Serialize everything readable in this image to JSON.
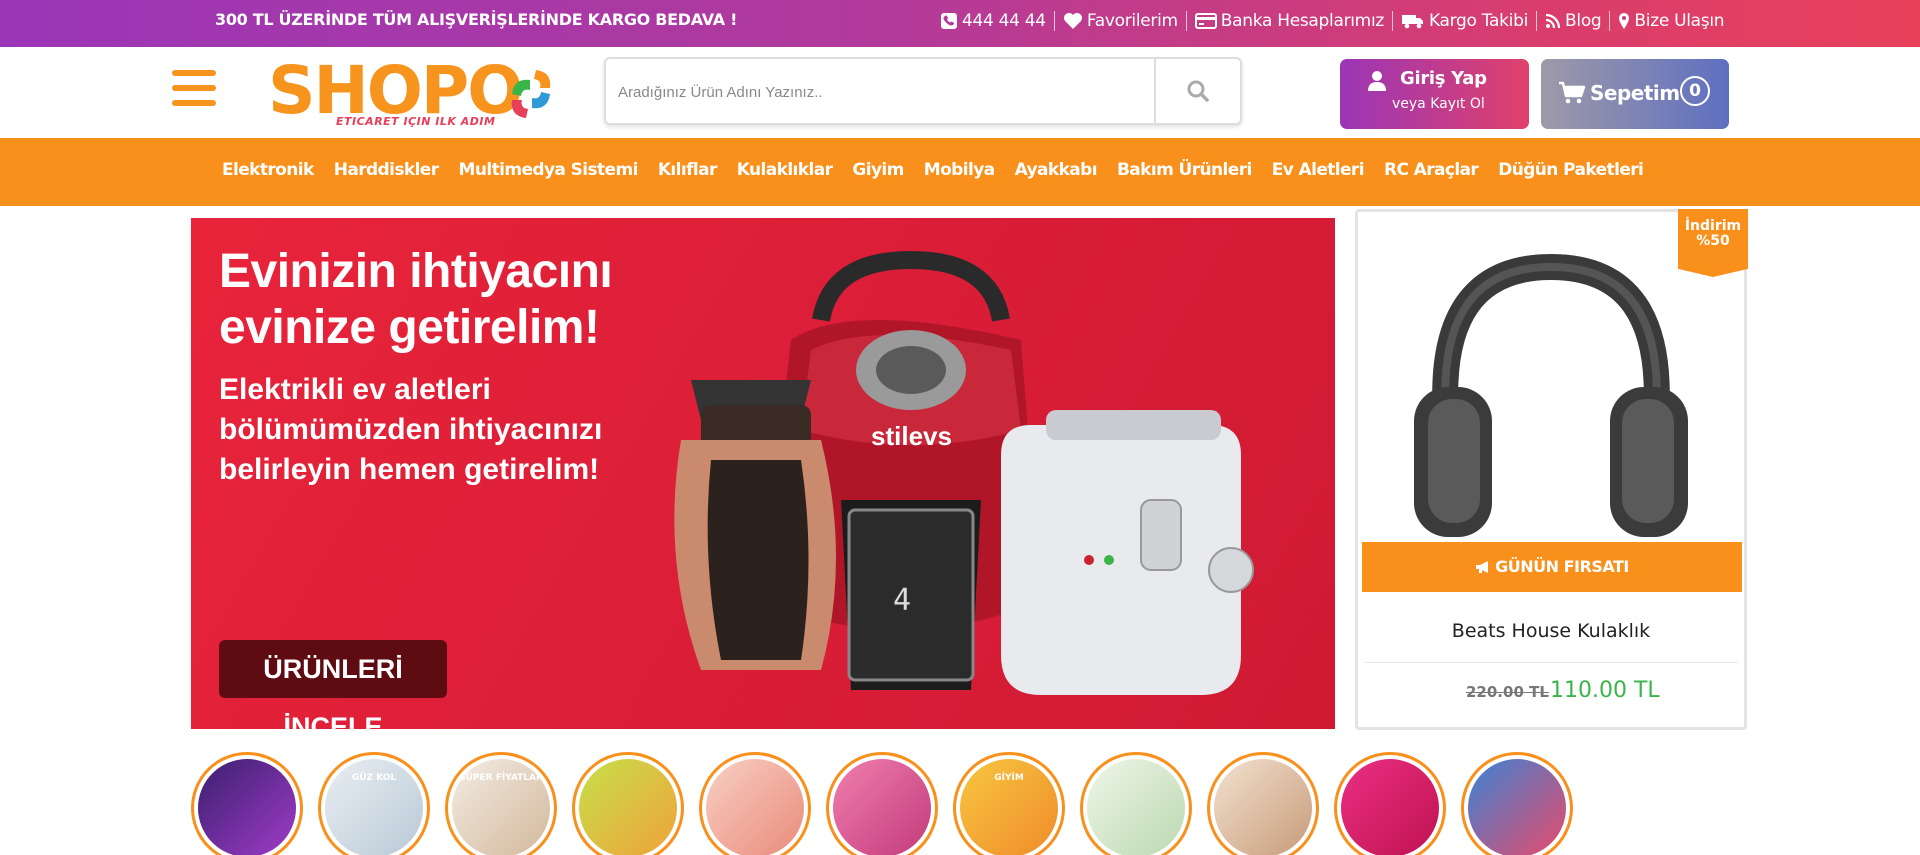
{
  "topbar": {
    "promo": "300 TL ÜZERİNDE TÜM ALIŞVERİŞLERİNDE KARGO BEDAVA !",
    "links": [
      {
        "icon": "phone-icon",
        "label": "444 44 44"
      },
      {
        "icon": "heart-icon",
        "label": "Favorilerim"
      },
      {
        "icon": "credit-card-icon",
        "label": "Banka Hesaplarımız"
      },
      {
        "icon": "truck-icon",
        "label": "Kargo Takibi"
      },
      {
        "icon": "rss-icon",
        "label": "Blog"
      },
      {
        "icon": "map-pin-icon",
        "label": "Bize Ulaşın"
      }
    ]
  },
  "header": {
    "logo_word": "SHOPO",
    "logo_tagline": "ETICARET IÇIN ILK ADIM",
    "search_placeholder": "Aradığınız Ürün Adını Yazınız..",
    "login_title": "Giriş Yap",
    "login_sub": "veya Kayıt Ol",
    "cart_label": "Sepetim",
    "cart_count": "0"
  },
  "nav": {
    "items": [
      "Elektronik",
      "Harddiskler",
      "Multimedya Sistemi",
      "Kılıflar",
      "Kulaklıklar",
      "Giyim",
      "Mobilya",
      "Ayakkabı",
      "Bakım Ürünleri",
      "Ev Aletleri",
      "RC Araçlar",
      "Düğün Paketleri"
    ]
  },
  "banner": {
    "line1": "Evinizin ihtiyacını",
    "line2": "evinize getirelim!",
    "sub1": "Elektrikli ev aletleri",
    "sub2": "bölümümüzden ihtiyacınızı",
    "sub3": "belirleyin hemen getirelim!",
    "cta": "ÜRÜNLERİ İNCELE",
    "brand_text": "stilevs",
    "bg_color": "#e0213a"
  },
  "deal": {
    "ribbon_line1": "İndirim",
    "ribbon_line2": "%50",
    "label": "GÜNÜN FIRSATI",
    "product_name": "Beats House Kulaklık",
    "old_price": "220.00 TL",
    "new_price": "110.00 TL",
    "accent": "#f8901b",
    "price_color": "#3ab54a"
  },
  "stories": [
    {
      "text": "",
      "color1": "#3a1f6e",
      "color2": "#a03cc8"
    },
    {
      "text": "GÜZ KOL",
      "color1": "#e8eef2",
      "color2": "#b9c9d6"
    },
    {
      "text": "SÜPER FİYATLAR",
      "color1": "#f3ece4",
      "color2": "#d2b89a"
    },
    {
      "text": "",
      "color1": "#c7e04a",
      "color2": "#f0a13a"
    },
    {
      "text": "",
      "color1": "#f8d0c4",
      "color2": "#e98a7a"
    },
    {
      "text": "",
      "color1": "#f07fb0",
      "color2": "#c23a7a"
    },
    {
      "text": "GİYİM",
      "color1": "#f7c640",
      "color2": "#ef8b2a"
    },
    {
      "text": "",
      "color1": "#eef6e8",
      "color2": "#bcd8b0"
    },
    {
      "text": "",
      "color1": "#f2e2d0",
      "color2": "#c89a78"
    },
    {
      "text": "",
      "color1": "#ea2f84",
      "color2": "#c0124f"
    },
    {
      "text": "",
      "color1": "#3a83d6",
      "color2": "#e94a6a"
    }
  ]
}
